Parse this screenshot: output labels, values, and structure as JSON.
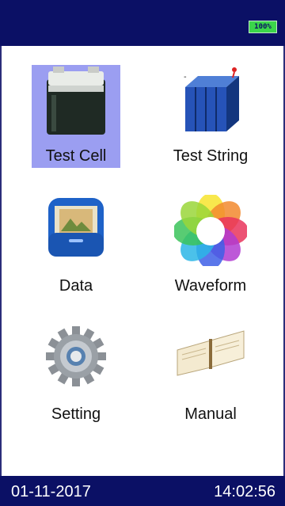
{
  "status_bar": {
    "battery": "100%"
  },
  "menu": [
    {
      "id": "test-cell",
      "label": "Test Cell",
      "icon": "battery-cell-icon",
      "selected": true
    },
    {
      "id": "test-string",
      "label": "Test String",
      "icon": "battery-string-icon",
      "selected": false
    },
    {
      "id": "data",
      "label": "Data",
      "icon": "folder-data-icon",
      "selected": false
    },
    {
      "id": "waveform",
      "label": "Waveform",
      "icon": "color-wheel-icon",
      "selected": false
    },
    {
      "id": "setting",
      "label": "Setting",
      "icon": "gear-icon",
      "selected": false
    },
    {
      "id": "manual",
      "label": "Manual",
      "icon": "book-icon",
      "selected": false
    }
  ],
  "footer": {
    "date": "01-11-2017",
    "time": "14:02:56"
  },
  "colors": {
    "bar": "#0b1065",
    "selection": "#9b9ef1",
    "battery": "#3bd54a"
  }
}
